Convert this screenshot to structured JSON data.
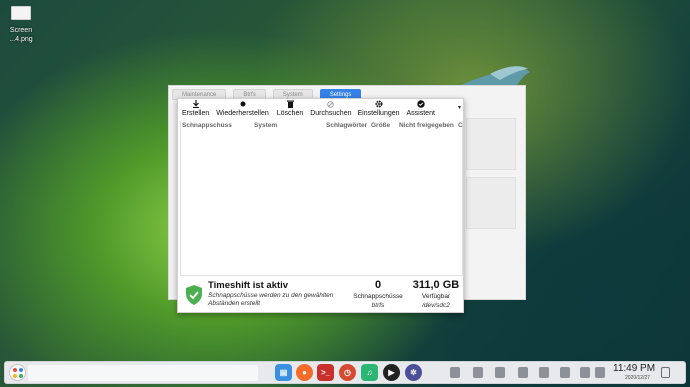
{
  "desktop": {
    "file_icon_label_line1": "Screen",
    "file_icon_label_line2": "...4.png"
  },
  "background_window": {
    "tabs": [
      {
        "label": "Maintenance"
      },
      {
        "label": "Btrfs"
      },
      {
        "label": "System"
      },
      {
        "label": "Settings",
        "active": true
      }
    ]
  },
  "toolbar": {
    "buttons": [
      {
        "label": "Erstellen",
        "icon": "download-icon"
      },
      {
        "label": "Wiederherstellen",
        "icon": "restore-icon"
      },
      {
        "label": "Löschen",
        "icon": "trash-icon"
      },
      {
        "label": "Durchsuchen",
        "icon": "browse-icon"
      },
      {
        "label": "Einstellungen",
        "icon": "gear-icon"
      },
      {
        "label": "Assistent",
        "icon": "wizard-check-icon"
      }
    ],
    "menu_icon": "menu-dropdown-icon"
  },
  "table": {
    "columns": [
      "Schnappschuss",
      "System",
      "Schlagwörter",
      "Größe",
      "Nicht freigegeben",
      "C"
    ]
  },
  "status": {
    "title": "Timeshift ist aktiv",
    "subtitle": "Schnappschüsse werden zu den gewählten Abständen erstellt",
    "snapshots_count": "0",
    "snapshots_label": "Schnappschüsse",
    "snapshots_type": "btrfs",
    "available_size": "311,0 GB",
    "available_label": "Verfügbar",
    "available_device": "/dev/sdc2",
    "accent_color": "#4caf50"
  },
  "taskbar": {
    "apps": [
      "files-icon",
      "firefox-icon",
      "terminal-icon",
      "timeshift-icon",
      "music-icon",
      "media-player-icon",
      "settings-icon"
    ],
    "tray_icons": [
      "tray-1-icon",
      "tray-2-icon",
      "tray-3-icon",
      "tray-4-icon",
      "tray-5-icon",
      "tray-6-icon",
      "tray-7-icon",
      "tray-8-icon"
    ],
    "clock_time": "11:49 PM",
    "clock_date": "2020/12/27"
  }
}
